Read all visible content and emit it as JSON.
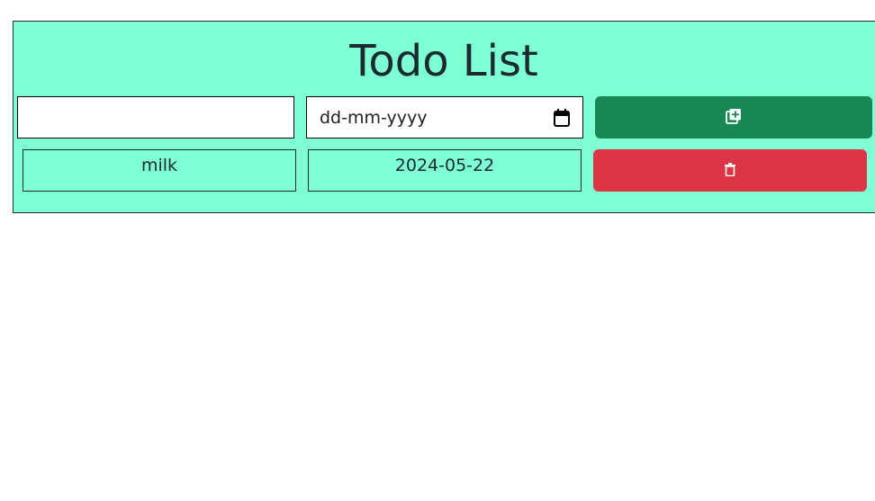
{
  "header": {
    "title": "Todo List"
  },
  "form": {
    "name_value": "",
    "date_placeholder": "dd-mm-yyyy",
    "add_icon": "add-copy-icon",
    "add_color": "#198754"
  },
  "todos": [
    {
      "name": "milk",
      "date": "2024-05-22",
      "delete_icon": "trash-icon",
      "delete_color": "#dc3545"
    }
  ],
  "colors": {
    "panel_background": "#7fffd4"
  }
}
